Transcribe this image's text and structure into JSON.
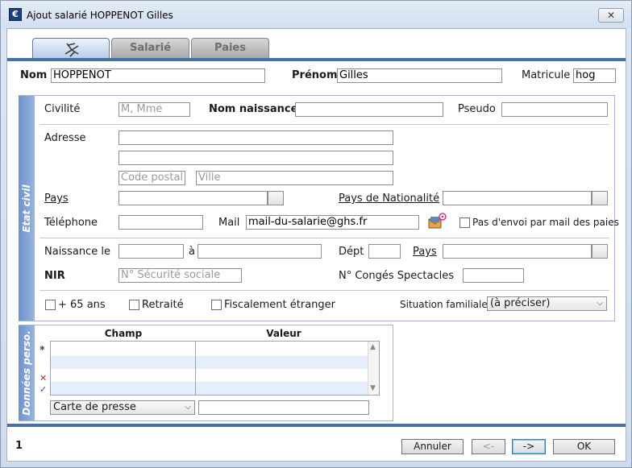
{
  "window": {
    "title": "Ajout salarié HOPPENOT Gilles",
    "close_label": "✕"
  },
  "tabs": [
    {
      "label": ""
    },
    {
      "label": "Salarié"
    },
    {
      "label": "Paies"
    }
  ],
  "header": {
    "nom_label": "Nom",
    "nom_value": "HOPPENOT",
    "prenom_label": "Prénom",
    "prenom_value": "Gilles",
    "matricule_label": "Matricule",
    "matricule_value": "hog"
  },
  "etat_civil": {
    "band_label": "Etat civil",
    "civilite_label": "Civilité",
    "civilite_placeholder": "M, Mme",
    "nom_naissance_label": "Nom naissance",
    "pseudo_label": "Pseudo",
    "adresse_label": "Adresse",
    "code_postal_placeholder": "Code postal",
    "ville_placeholder": "Ville",
    "pays_label": "Pays",
    "pays_nationalite_label": "Pays de Nationalité",
    "telephone_label": "Téléphone",
    "mail_label": "Mail",
    "mail_value": "mail-du-salarie@ghs.fr",
    "no_mail_label": "Pas d'envoi par mail des paies",
    "naissance_label": "Naissance le",
    "a_label": "à",
    "dept_label": "Dépt",
    "pays_naissance_label": "Pays",
    "nir_label": "NIR",
    "nir_placeholder": "N° Sécurité sociale",
    "conges_label": "N° Congés Spectacles",
    "plus65_label": "+ 65 ans",
    "retraite_label": "Retraité",
    "fiscal_label": "Fiscalement étranger",
    "situation_label": "Situation familiale",
    "situation_value": "(à préciser)"
  },
  "donnees": {
    "band_label": "Données perso.",
    "col_champ": "Champ",
    "col_valeur": "Valeur",
    "select_value": "Carte de presse"
  },
  "footer": {
    "page_number": "1",
    "annuler_label": "Annuler",
    "prev_label": "<-",
    "next_label": "->",
    "ok_label": "OK"
  },
  "colors": {
    "accent": "#4a6fa8",
    "band": "#7f9fd6"
  }
}
